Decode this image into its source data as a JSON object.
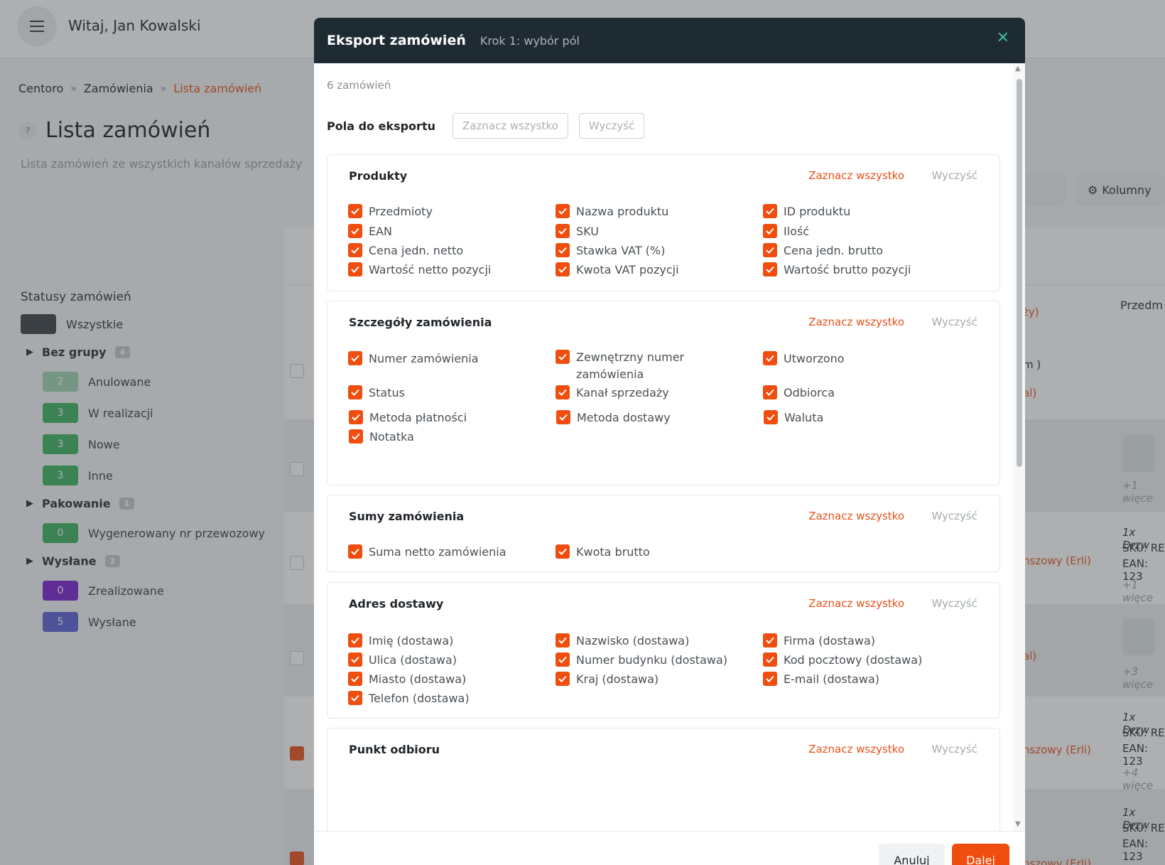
{
  "app": {
    "greeting": "Witaj, Jan Kowalski"
  },
  "breadcrumb": [
    "Centoro",
    "Zamówienia",
    "Lista zamówień"
  ],
  "page": {
    "title": "Lista zamówień",
    "subtitle": "Lista zamówień ze wszystkich kanałów sprzedaży"
  },
  "statuses": {
    "heading": "Statusy zamówień",
    "all_label": "Wszystkie",
    "groups": [
      {
        "name": "Bez grupy",
        "count": "4",
        "items": [
          {
            "label": "Anulowane",
            "count": "2",
            "color": "#9ed5b0"
          },
          {
            "label": "W realizacji",
            "count": "3",
            "color": "#3cb45e"
          },
          {
            "label": "Nowe",
            "count": "3",
            "color": "#3cb45e"
          },
          {
            "label": "Inne",
            "count": "3",
            "color": "#3cb45e"
          }
        ]
      },
      {
        "name": "Pakowanie",
        "count": "1",
        "items": [
          {
            "label": "Wygenerowany nr przewozowy",
            "count": "0",
            "color": "#3cb45e"
          }
        ]
      },
      {
        "name": "Wysłane",
        "count": "2",
        "items": [
          {
            "label": "Zrealizowane",
            "count": "0",
            "color": "#7b1fd1"
          },
          {
            "label": "Wysłane",
            "count": "5",
            "color": "#5b5fd6"
          }
        ]
      }
    ]
  },
  "background_table": {
    "toolbar_columns": "Kolumny",
    "toolbar_partial": "wane",
    "header_partial": "Przedm",
    "header_partial_2": "ży)",
    "cells": [
      "m )",
      "al)",
      "+1 więce",
      "1x Drzw",
      "SKU: RE",
      "EAN: 123",
      "nszowy (Erli)",
      "+1 więce",
      "al)",
      "+3 więce",
      "1x Drzw",
      "SKU: RE",
      "EAN: 123",
      "nszowy (Erli)",
      "+4 więce",
      "1x Drzw",
      "SKU: RE",
      "EAN: 123",
      "nszowy (Erli)"
    ]
  },
  "modal": {
    "title": "Eksport zamówień",
    "step": "Krok 1: wybór pól",
    "orders_count": "6 zamówień",
    "fields_label": "Pola do eksportu",
    "select_all": "Zaznacz wszystko",
    "clear": "Wyczyść",
    "cancel": "Anuluj",
    "next": "Dalej",
    "sections": [
      {
        "title": "Produkty",
        "select_all": "Zaznacz wszystko",
        "clear": "Wyczyść",
        "items": [
          "Przedmioty",
          "Nazwa produktu",
          "ID produktu",
          "EAN",
          "SKU",
          "Ilość",
          "Cena jedn. netto",
          "Stawka VAT (%)",
          "Cena jedn. brutto",
          "Wartość netto pozycji",
          "Kwota VAT pozycji",
          "Wartość brutto pozycji"
        ]
      },
      {
        "title": "Szczegóły zamówienia",
        "select_all": "Zaznacz wszystko",
        "clear": "Wyczyść",
        "items": [
          "Numer zamówienia",
          "Zewnętrzny numer zamówienia",
          "Utworzono",
          "Status",
          "Kanał sprzedaży",
          "Odbiorca",
          "Metoda płatności",
          "Metoda dostawy",
          "Waluta",
          "Notatka"
        ]
      },
      {
        "title": "Sumy zamówienia",
        "select_all": "Zaznacz wszystko",
        "clear": "Wyczyść",
        "items": [
          "Suma netto zamówienia",
          "Kwota brutto"
        ]
      },
      {
        "title": "Adres dostawy",
        "select_all": "Zaznacz wszystko",
        "clear": "Wyczyść",
        "items": [
          "Imię (dostawa)",
          "Nazwisko (dostawa)",
          "Firma (dostawa)",
          "Ulica (dostawa)",
          "Numer budynku (dostawa)",
          "Kod pocztowy (dostawa)",
          "Miasto (dostawa)",
          "Kraj (dostawa)",
          "E-mail (dostawa)",
          "Telefon (dostawa)"
        ]
      },
      {
        "title": "Punkt odbioru",
        "select_all": "Zaznacz wszystko",
        "clear": "Wyczyść",
        "items": []
      }
    ],
    "accent_color": "#f04e0f"
  }
}
